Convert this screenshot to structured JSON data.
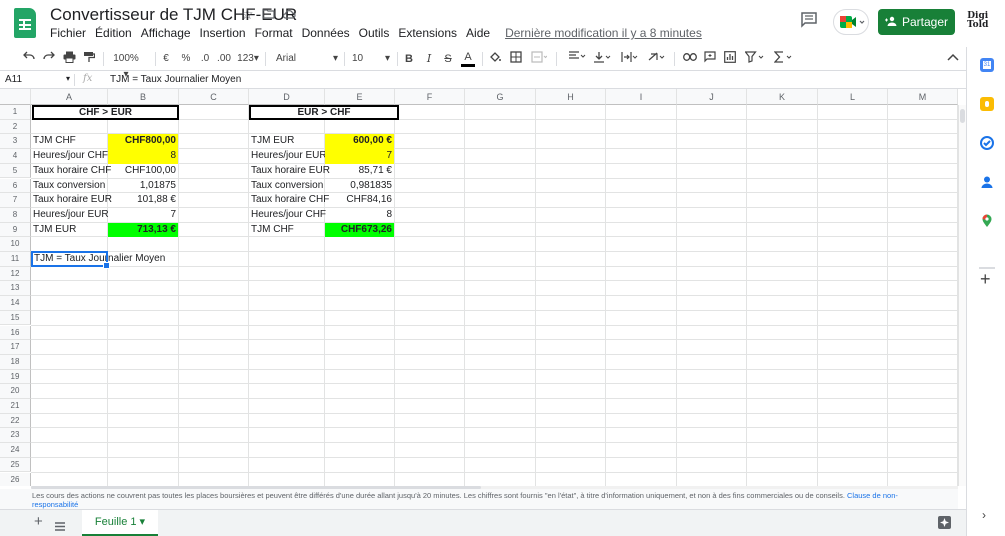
{
  "app": {
    "title": "Convertisseur de TJM CHF-EUR",
    "last_edit": "Dernière modification il y a 8 minutes",
    "share_label": "Partager",
    "account_label": "Digi\nTold"
  },
  "menu": [
    "Fichier",
    "Édition",
    "Affichage",
    "Insertion",
    "Format",
    "Données",
    "Outils",
    "Extensions",
    "Aide"
  ],
  "toolbar": {
    "zoom": "100%",
    "currency": "€",
    "percent": "%",
    "dec_less": ".0",
    "dec_more": ".00",
    "more_formats": "123",
    "font": "Arial",
    "font_size": "10",
    "bold": "B",
    "italic": "I",
    "strike": "S",
    "text_color": "A"
  },
  "formula_bar": {
    "cell_ref": "A11",
    "fx": "fx",
    "value": "TJM = Taux Journalier Moyen"
  },
  "columns": [
    "A",
    "B",
    "C",
    "D",
    "E",
    "F",
    "G",
    "H",
    "I",
    "J",
    "K",
    "L",
    "M"
  ],
  "rows": [
    "1",
    "2",
    "3",
    "4",
    "5",
    "6",
    "7",
    "8",
    "9",
    "10",
    "11",
    "12",
    "13",
    "14",
    "15",
    "16",
    "17",
    "18",
    "19",
    "20",
    "21",
    "22",
    "23",
    "24",
    "25",
    "26"
  ],
  "sheet": {
    "left_title": "CHF > EUR",
    "right_title": "EUR > CHF",
    "left": [
      {
        "label": "TJM CHF",
        "value": "CHF800,00"
      },
      {
        "label": "Heures/jour CHF",
        "value": "8"
      },
      {
        "label": "Taux horaire CHF",
        "value": "CHF100,00"
      },
      {
        "label": "Taux conversion",
        "value": "1,01875"
      },
      {
        "label": "Taux horaire EUR",
        "value": "101,88 €"
      },
      {
        "label": "Heures/jour EUR",
        "value": "7"
      },
      {
        "label": "TJM EUR",
        "value": "713,13 €"
      }
    ],
    "right": [
      {
        "label": "TJM EUR",
        "value": "600,00 €"
      },
      {
        "label": "Heures/jour EUR",
        "value": "7"
      },
      {
        "label": "Taux horaire EUR",
        "value": "85,71 €"
      },
      {
        "label": "Taux conversion",
        "value": "0,981835"
      },
      {
        "label": "Taux horaire CHF",
        "value": "CHF84,16"
      },
      {
        "label": "Heures/jour CHF",
        "value": "8"
      },
      {
        "label": "TJM CHF",
        "value": "CHF673,26"
      }
    ],
    "note": "TJM = Taux Journalier Moyen"
  },
  "footer": {
    "disclaimer": "Les cours des actions ne couvrent pas toutes les places boursières et peuvent être différés d'une durée allant jusqu'à 20 minutes. Les chiffres sont fournis \"en l'état\", à titre d'information uniquement, et non à des fins commerciales ou de conseils.",
    "disclaimer_link": "Clause de non-responsabilité",
    "sheet_tab": "Feuille 1"
  },
  "colors": {
    "brand_green": "#188038",
    "highlight_yellow": "#ffff00",
    "highlight_green": "#00ff00",
    "selection_blue": "#1a73e8"
  }
}
